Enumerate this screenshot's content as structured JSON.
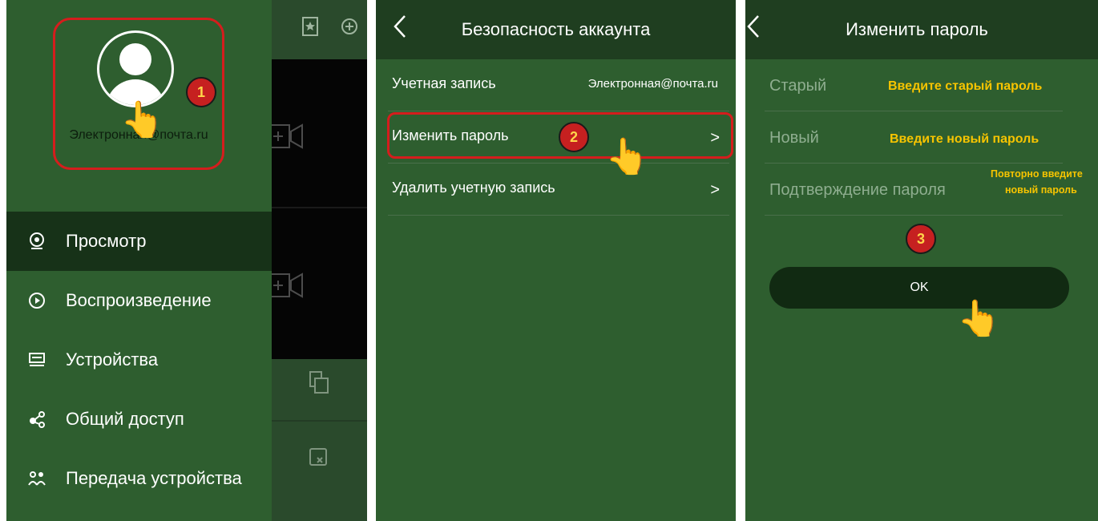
{
  "panel1": {
    "email": "Электронная@почта.ru",
    "badge": "1",
    "menu": [
      {
        "label": "Просмотр",
        "icon": "camera-icon",
        "active": true
      },
      {
        "label": "Воспроизведение",
        "icon": "play-icon",
        "active": false
      },
      {
        "label": "Устройства",
        "icon": "device-icon",
        "active": false
      },
      {
        "label": "Общий доступ",
        "icon": "share-icon",
        "active": false
      },
      {
        "label": "Передача устройства",
        "icon": "transfer-icon",
        "active": false
      }
    ]
  },
  "panel2": {
    "title": "Безопасность аккаунта",
    "badge": "2",
    "rows": [
      {
        "label": "Учетная запись",
        "value": "Электронная@почта.ru"
      },
      {
        "label": "Изменить пароль",
        "value": ""
      },
      {
        "label": "Удалить учетную запись",
        "value": ""
      }
    ]
  },
  "panel3": {
    "title": "Изменить пароль",
    "badge": "3",
    "fields": [
      {
        "label": "Старый",
        "hint": "Введите старый пароль"
      },
      {
        "label": "Новый",
        "hint": "Введите новый пароль"
      },
      {
        "label": "Подтверждение пароля",
        "hint_line1": "Повторно введите",
        "hint_line2": "новый пароль"
      }
    ],
    "ok_label": "OK"
  },
  "colors": {
    "app_green": "#2e5e2f",
    "header_green": "#1f3e20",
    "highlight_red": "#d51d1d",
    "hint_yellow": "#f7c400"
  }
}
